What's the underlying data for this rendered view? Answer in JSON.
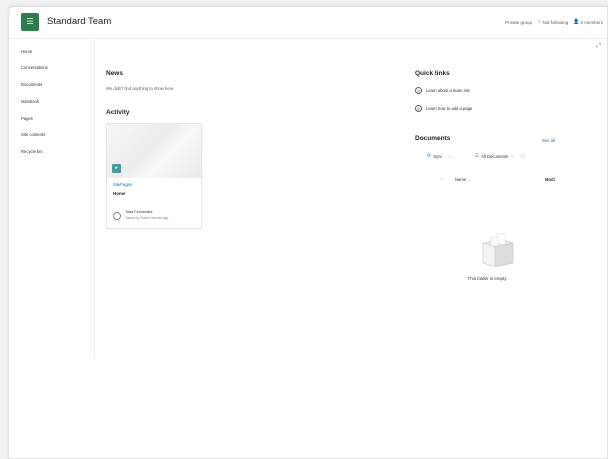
{
  "site": {
    "logo_glyph": "☰",
    "title": "Standard Team"
  },
  "header": {
    "group_type": "Private group",
    "follow_label": "Not following",
    "members_label": "2 members"
  },
  "nav": {
    "items": [
      "Home",
      "Conversations",
      "Documents",
      "Notebook",
      "Pages",
      "Site contents",
      "Recycle bin"
    ]
  },
  "news": {
    "title": "News",
    "empty_text": "We didn't find anything to show here."
  },
  "activity": {
    "title": "Activity",
    "card": {
      "link_text": "SitePages",
      "name": "Home",
      "author": "Todd Fernandes",
      "meta": "Viewed by Todd a minutes ago"
    }
  },
  "quick_links": {
    "title": "Quick links",
    "items": [
      "Learn about a team site",
      "Learn how to add a page"
    ]
  },
  "documents": {
    "title": "Documents",
    "see_all": "See all",
    "toolbar": {
      "sync_label": "Sync",
      "more_label": "...",
      "view_label": "All Documents",
      "info_label": "ⓘ"
    },
    "columns": [
      "Name",
      "Modi"
    ],
    "empty_text": "This folder is empty"
  },
  "colors": {
    "accent": "#0f6cbd",
    "logo_bg": "#2e7d4f",
    "badge_bg": "#4a9c9a"
  }
}
